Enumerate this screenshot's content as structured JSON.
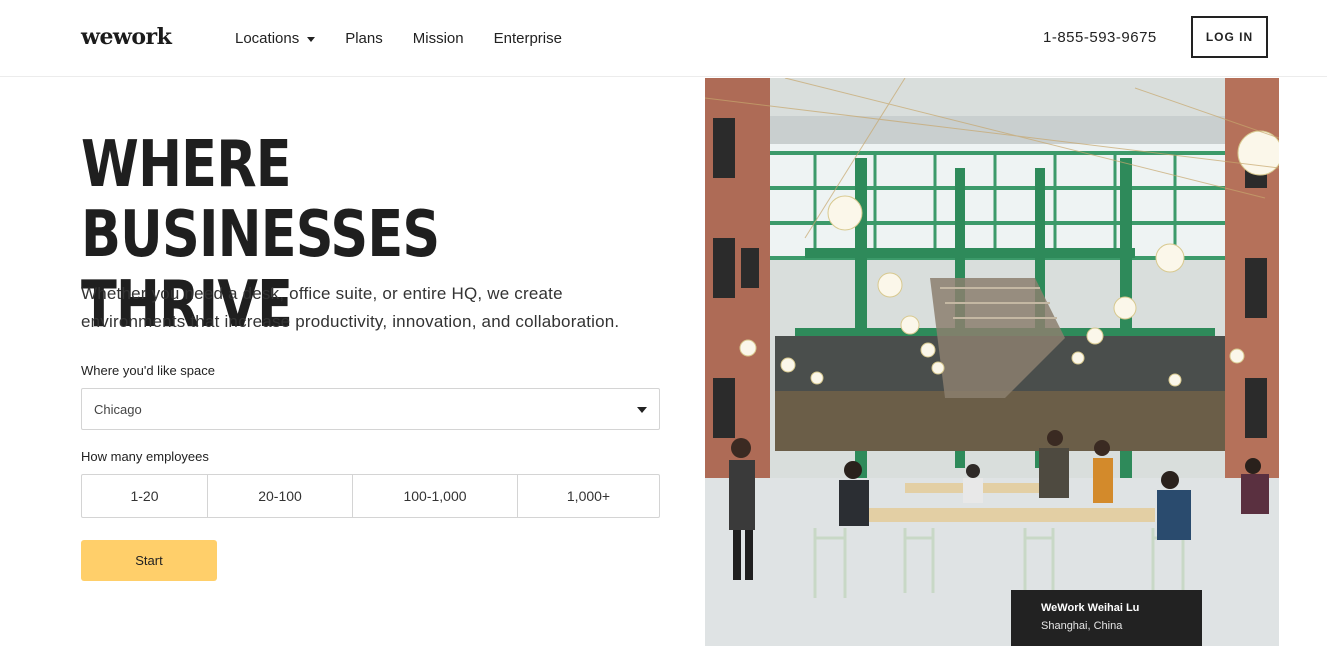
{
  "header": {
    "logo": "wework",
    "nav": [
      {
        "label": "Locations",
        "has_dropdown": true
      },
      {
        "label": "Plans"
      },
      {
        "label": "Mission"
      },
      {
        "label": "Enterprise"
      }
    ],
    "phone": "1-855-593-9675",
    "login_label": "LOG IN"
  },
  "hero": {
    "title_line1": "WHERE BUSINESSES",
    "title_line2": "THRIVE",
    "subtitle_line1": "Whether you need a desk, office suite, or entire HQ, we create",
    "subtitle_line2": "environments that increase productivity, innovation, and collaboration."
  },
  "form": {
    "location_label": "Where you'd like space",
    "location_value": "Chicago",
    "employees_label": "How many employees",
    "employee_options": [
      "1-20",
      "20-100",
      "100-1,000",
      "1,000+"
    ],
    "start_label": "Start"
  },
  "photo": {
    "caption_title": "WeWork Weihai Lu",
    "caption_location": "Shanghai, China"
  },
  "colors": {
    "accent": "#ffcf6a",
    "text": "#222222",
    "caption_bg": "#222222",
    "frame_green": "#2e8a5a"
  }
}
